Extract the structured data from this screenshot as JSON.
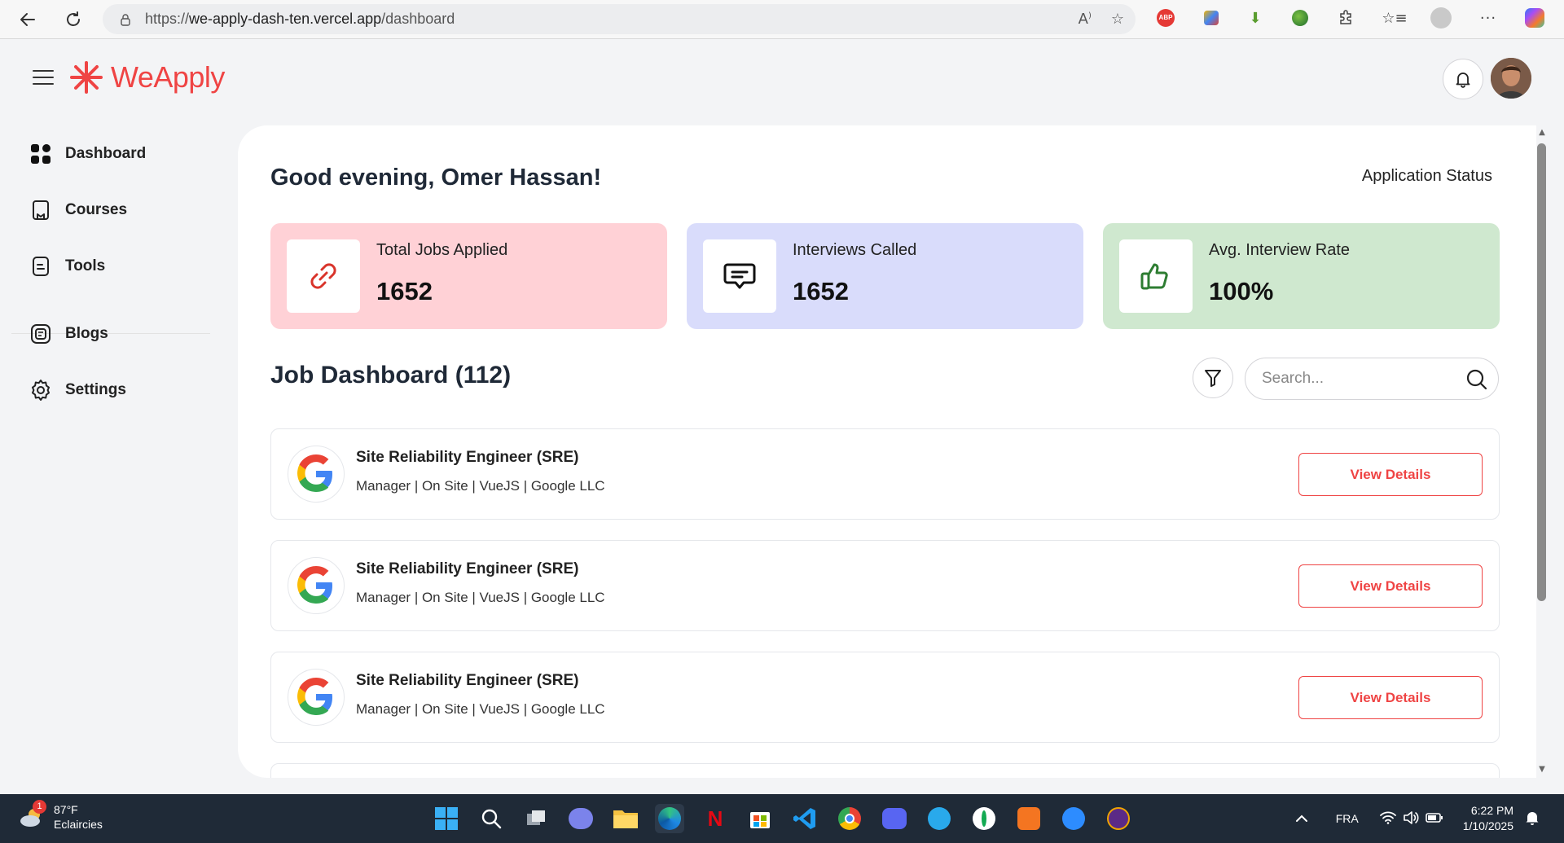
{
  "browser": {
    "url_prefix": "https://",
    "url_host": "we-apply-dash-ten.vercel.app",
    "url_path": "/dashboard",
    "extensions": [
      "read-aloud-icon",
      "favorite-star-icon",
      "adblock-icon",
      "extension-puzzle-icon",
      "favorites-icon",
      "profile-icon",
      "more-icon",
      "copilot-icon"
    ]
  },
  "header": {
    "brand": "WeApply",
    "brand_color": "#ef4444"
  },
  "sidebar": {
    "items": [
      {
        "label": "Dashboard"
      },
      {
        "label": "Courses"
      },
      {
        "label": "Tools"
      },
      {
        "label": "Blogs"
      },
      {
        "label": "Settings"
      }
    ]
  },
  "main": {
    "greeting": "Good evening, Omer Hassan!",
    "status_link": "Application Status",
    "stats": [
      {
        "label": "Total Jobs Applied",
        "value": "1652",
        "color": "#ffd1d6",
        "icon": "link-icon",
        "icon_color": "#d9342b"
      },
      {
        "label": "Interviews Called",
        "value": "1652",
        "color": "#d9dcfb",
        "icon": "message-icon",
        "icon_color": "#111111"
      },
      {
        "label": "Avg. Interview Rate",
        "value": "100%",
        "color": "#cfe8cf",
        "icon": "thumbs-up-icon",
        "icon_color": "#2e7d32"
      }
    ],
    "job_dashboard_title": "Job Dashboard (112)",
    "search_placeholder": "Search...",
    "jobs": [
      {
        "title": "Site Reliability Engineer (SRE)",
        "meta": "Manager | On Site | VueJS | Google LLC",
        "button": "View Details"
      },
      {
        "title": "Site Reliability Engineer (SRE)",
        "meta": "Manager | On Site | VueJS | Google LLC",
        "button": "View Details"
      },
      {
        "title": "Site Reliability Engineer (SRE)",
        "meta": "Manager | On Site | VueJS | Google LLC",
        "button": "View Details"
      }
    ]
  },
  "taskbar": {
    "weather_badge": "1",
    "temperature": "87°F",
    "condition": "Eclaircies",
    "language": "FRA",
    "time": "6:22 PM",
    "date": "1/10/2025"
  }
}
